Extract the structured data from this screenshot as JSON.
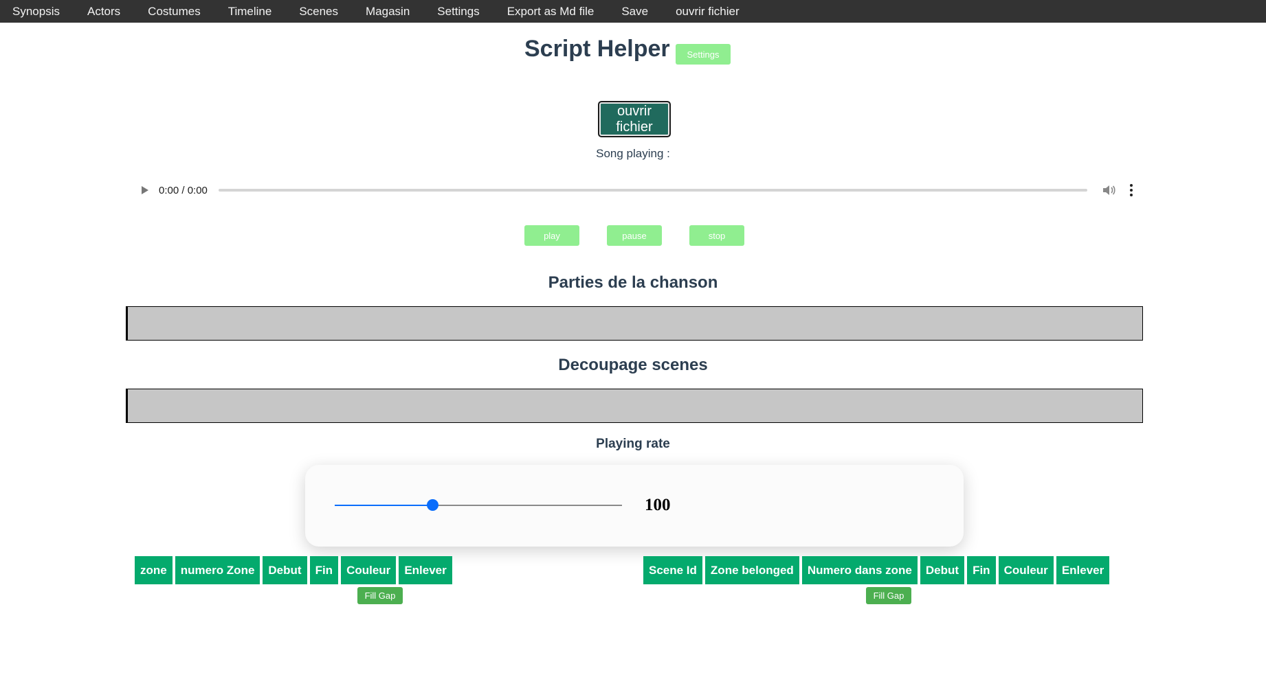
{
  "nav": {
    "items": [
      "Synopsis",
      "Actors",
      "Costumes",
      "Timeline",
      "Scenes",
      "Magasin",
      "Settings",
      "Export as Md file",
      "Save",
      "ouvrir fichier"
    ]
  },
  "header": {
    "title": "Script Helper",
    "settings_label": "Settings"
  },
  "open_file": {
    "label": "ouvrir fichier"
  },
  "song": {
    "playing_label": "Song playing :"
  },
  "audio": {
    "time": "0:00 / 0:00",
    "progress": 0
  },
  "controls": {
    "play": "play",
    "pause": "pause",
    "stop": "stop"
  },
  "sections": {
    "parties": "Parties de la chanson",
    "decoupage": "Decoupage scenes"
  },
  "rate": {
    "label": "Playing rate",
    "value": "100",
    "slider_fraction": 0.34
  },
  "zones_table": {
    "headers": [
      "zone",
      "numero Zone",
      "Debut",
      "Fin",
      "Couleur",
      "Enlever"
    ],
    "fill_gap": "Fill Gap"
  },
  "scenes_table": {
    "headers": [
      "Scene Id",
      "Zone belonged",
      "Numero dans zone",
      "Debut",
      "Fin",
      "Couleur",
      "Enlever"
    ],
    "fill_gap": "Fill Gap"
  },
  "colors": {
    "nav_bg": "#333333",
    "accent_light": "#90ee90",
    "header_green": "#04aa6d",
    "open_btn": "#206a5d",
    "slider": "#0a6dfb"
  }
}
